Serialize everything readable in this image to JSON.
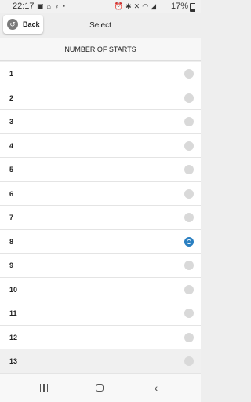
{
  "status_bar": {
    "time": "22:17",
    "battery": "17%",
    "battery_level": 0.17,
    "left_icons": [
      "image-icon",
      "cast-icon",
      "usb-icon",
      "dot-icon"
    ],
    "right_icons": [
      "alarm-icon",
      "bluetooth-icon",
      "mute-icon",
      "wifi-icon",
      "signal-icon"
    ]
  },
  "header": {
    "back_label": "Back",
    "title": "Select"
  },
  "section_header": "NUMBER OF STARTS",
  "options": [
    {
      "label": "1",
      "selected": false
    },
    {
      "label": "2",
      "selected": false
    },
    {
      "label": "3",
      "selected": false
    },
    {
      "label": "4",
      "selected": false
    },
    {
      "label": "5",
      "selected": false
    },
    {
      "label": "6",
      "selected": false
    },
    {
      "label": "7",
      "selected": false
    },
    {
      "label": "8",
      "selected": true
    },
    {
      "label": "9",
      "selected": false
    },
    {
      "label": "10",
      "selected": false
    },
    {
      "label": "11",
      "selected": false
    },
    {
      "label": "12",
      "selected": false
    },
    {
      "label": "13",
      "selected": false
    }
  ],
  "colors": {
    "accent": "#2a7fc1",
    "background": "#eeeeee",
    "row_background": "#ffffff",
    "unselected_radio": "#d9d9d9"
  },
  "nav_bar": {
    "icons": [
      "recent-apps-icon",
      "home-icon",
      "back-icon"
    ]
  }
}
